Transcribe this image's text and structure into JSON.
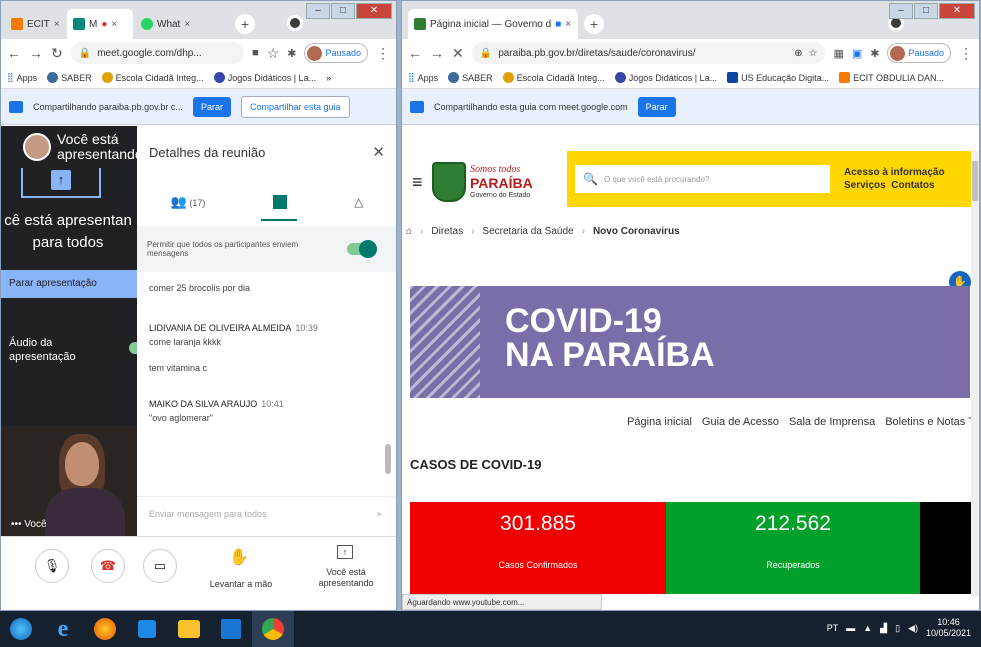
{
  "left_window": {
    "tabs": [
      {
        "label": "ECIT",
        "close": "×"
      },
      {
        "label": "M",
        "close": "×"
      },
      {
        "label": "What",
        "close": "×"
      }
    ],
    "url": "meet.google.com/dhp...",
    "profile_label": "Pausado",
    "bookmarks": [
      "Apps",
      "SABER",
      "Escola Cidadã Integ...",
      "Jogos Didáticos | La..."
    ],
    "share_text": "Compartilhando paraiba.pb.gov.br c...",
    "stop_label": "Parar",
    "share_tab_label": "Compartilhar esta guia",
    "presenting_header": "Você está apresentando",
    "presenting_big": "cê está apresentan para todos",
    "stop_presenting": "Parar apresentação",
    "audio_label": "Áudio da apresentação",
    "self_label": "Você",
    "panel_title": "Detalhes da reunião",
    "people_count": "(17)",
    "allow_text": "Permitir que todos os participantes enviem mensagens",
    "messages": [
      {
        "sender": "",
        "time": "",
        "text": "comer 25 brocolis por dia"
      },
      {
        "sender": "LIDIVANIA DE OLIVEIRA ALMEIDA",
        "time": "10:39",
        "text": "come laranja kkkk"
      },
      {
        "sender": "",
        "time": "",
        "text": "tem vitamina c"
      },
      {
        "sender": "MAIKO DA SILVA ARAUJO",
        "time": "10:41",
        "text": "\"ovo aglomerar\""
      }
    ],
    "chat_placeholder": "Enviar mensagem para todos",
    "raise_hand": "Levantar a mão",
    "presenting_ctrl": "Você está apresentando"
  },
  "right_window": {
    "tab_title": "Página inicial — Governo d",
    "url": "paraiba.pb.gov.br/diretas/saude/coronavirus/",
    "profile_label": "Pausado",
    "bookmarks": [
      "Apps",
      "SABER",
      "Escola Cidadã Integ...",
      "Jogos Didáticos | La...",
      "US Educação Digita...",
      "ECIT OBDULIA DAN..."
    ],
    "share_text": "Compartilhando esta guia com meet.google.com",
    "stop_label": "Parar",
    "logo_script": "Somos todos",
    "logo_name": "PARAÍBA",
    "logo_sub": "Governo do Estado",
    "search_placeholder": "O que você está procurando?",
    "access_info": "Acesso à informação",
    "services": "Serviços",
    "contacts": "Contatos",
    "breadcrumb": [
      "Diretas",
      "Secretaria da Saúde",
      "Novo Coronavirus"
    ],
    "banner_line1": "COVID-19",
    "banner_line2": "NA PARAÍBA",
    "subnav": [
      "Página inicial",
      "Guia de Acesso",
      "Sala de Imprensa",
      "Boletins e Notas Té"
    ],
    "section_title": "CASOS DE COVID-19",
    "cards": [
      {
        "value": "301.885",
        "label": "Casos Confirmados",
        "color": "#f00000"
      },
      {
        "value": "212.562",
        "label": "Recuperados",
        "color": "#00a02a"
      }
    ],
    "status": "Aguardando www.youtube.com..."
  },
  "taskbar": {
    "lang": "PT",
    "time": "10:46",
    "date": "10/05/2021"
  }
}
